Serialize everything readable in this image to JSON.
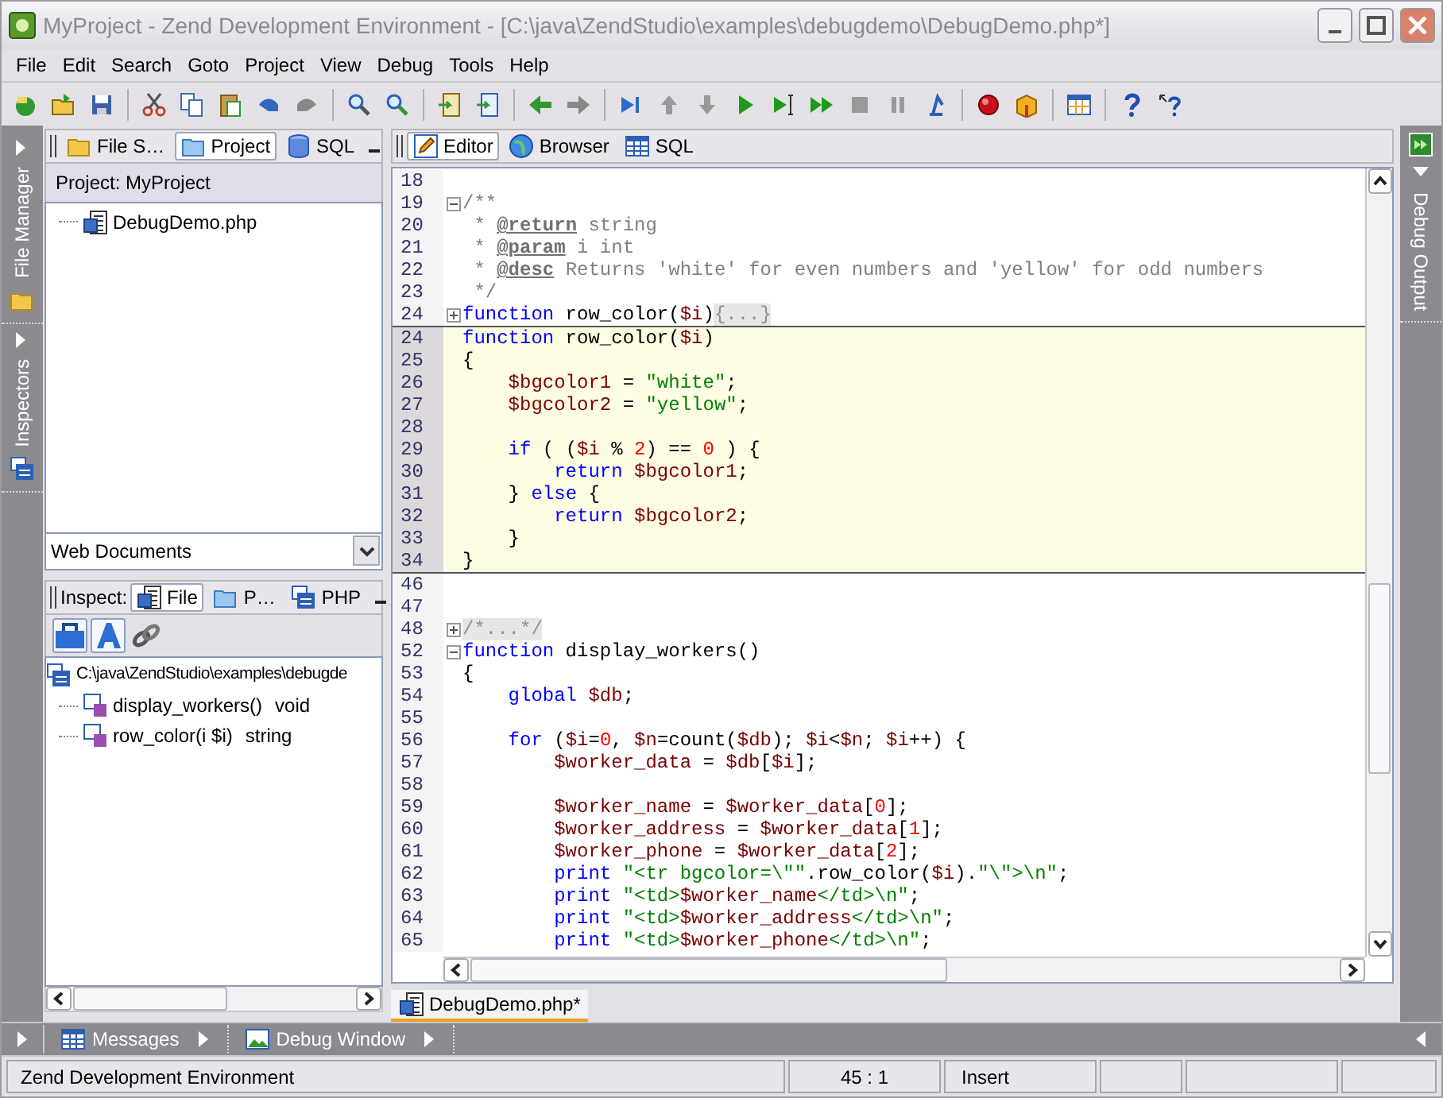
{
  "window": {
    "title": "MyProject - Zend Development Environment - [C:\\java\\ZendStudio\\examples\\debugdemo\\DebugDemo.php*]"
  },
  "menu": [
    "File",
    "Edit",
    "Search",
    "Goto",
    "Project",
    "View",
    "Debug",
    "Tools",
    "Help"
  ],
  "left_sidebar": [
    {
      "label": "File Manager"
    },
    {
      "label": "Inspectors"
    }
  ],
  "project_panel": {
    "tabs": [
      {
        "label": "File S…",
        "selected": false
      },
      {
        "label": "Project",
        "selected": true
      },
      {
        "label": "SQL",
        "selected": false
      }
    ],
    "header": "Project: MyProject",
    "tree": [
      {
        "label": "DebugDemo.php"
      }
    ],
    "dropdown": {
      "value": "Web Documents"
    }
  },
  "inspector_panel": {
    "label": "Inspect:",
    "tabs": [
      {
        "label": "File",
        "selected": true
      },
      {
        "label": "P…",
        "selected": false
      },
      {
        "label": "PHP",
        "selected": false
      }
    ],
    "tree": [
      {
        "label": "C:\\java\\ZendStudio\\examples\\debugde",
        "children": [
          {
            "label": "display_workers()",
            "type": "void"
          },
          {
            "label": "row_color(i $i)",
            "type": "string"
          }
        ]
      }
    ]
  },
  "editor_tabs": [
    {
      "label": "Editor",
      "selected": true
    },
    {
      "label": "Browser",
      "selected": false
    },
    {
      "label": "SQL",
      "selected": false
    }
  ],
  "code_sections": [
    {
      "kind": "main",
      "lines": [
        {
          "n": "18"
        },
        {
          "n": "19",
          "fold_expanded": true,
          "tokens": [
            {
              "kind": "doc",
              "text": "/**"
            }
          ]
        },
        {
          "n": "20",
          "tokens": [
            {
              "kind": "doc",
              "text": " * "
            },
            {
              "kind": "doctag",
              "text": "@return"
            },
            {
              "kind": "doc",
              "text": " string"
            }
          ]
        },
        {
          "n": "21",
          "tokens": [
            {
              "kind": "doc",
              "text": " * "
            },
            {
              "kind": "doctag",
              "text": "@param"
            },
            {
              "kind": "doc",
              "text": " i int"
            }
          ]
        },
        {
          "n": "22",
          "tokens": [
            {
              "kind": "doc",
              "text": " * "
            },
            {
              "kind": "doctag",
              "text": "@desc"
            },
            {
              "kind": "doc",
              "text": " Returns 'white' for even numbers and 'yellow' for odd numbers"
            }
          ]
        },
        {
          "n": "23",
          "tokens": [
            {
              "kind": "doc",
              "text": " */"
            }
          ]
        },
        {
          "n": "24",
          "fold_expanded": false,
          "tokens": [
            {
              "kind": "kw",
              "text": "function"
            },
            {
              "kind": "plain",
              "text": " row_color("
            },
            {
              "kind": "var",
              "text": "$i"
            },
            {
              "kind": "plain",
              "text": ")"
            },
            {
              "kind": "folded",
              "text": "{...}"
            }
          ]
        }
      ]
    },
    {
      "kind": "peek",
      "lines": [
        {
          "n": "24",
          "tokens": [
            {
              "kind": "kw",
              "text": "function"
            },
            {
              "kind": "plain",
              "text": " row_color("
            },
            {
              "kind": "var",
              "text": "$i"
            },
            {
              "kind": "plain",
              "text": ")"
            }
          ]
        },
        {
          "n": "25",
          "tokens": [
            {
              "kind": "plain",
              "text": "{"
            }
          ]
        },
        {
          "n": "26",
          "tokens": [
            {
              "kind": "var",
              "text": "    $bgcolor1"
            },
            {
              "kind": "plain",
              "text": " = "
            },
            {
              "kind": "str",
              "text": "\"white\""
            },
            {
              "kind": "plain",
              "text": ";"
            }
          ]
        },
        {
          "n": "27",
          "tokens": [
            {
              "kind": "var",
              "text": "    $bgcolor2"
            },
            {
              "kind": "plain",
              "text": " = "
            },
            {
              "kind": "str",
              "text": "\"yellow\""
            },
            {
              "kind": "plain",
              "text": ";"
            }
          ]
        },
        {
          "n": "28"
        },
        {
          "n": "29",
          "tokens": [
            {
              "kind": "kw",
              "text": "    if"
            },
            {
              "kind": "plain",
              "text": " ( ("
            },
            {
              "kind": "var",
              "text": "$i"
            },
            {
              "kind": "plain",
              "text": " % "
            },
            {
              "kind": "num",
              "text": "2"
            },
            {
              "kind": "plain",
              "text": ") == "
            },
            {
              "kind": "num",
              "text": "0"
            },
            {
              "kind": "plain",
              "text": " ) {"
            }
          ]
        },
        {
          "n": "30",
          "tokens": [
            {
              "kind": "kw",
              "text": "        return"
            },
            {
              "kind": "var",
              "text": " $bgcolor1"
            },
            {
              "kind": "plain",
              "text": ";"
            }
          ]
        },
        {
          "n": "31",
          "tokens": [
            {
              "kind": "plain",
              "text": "    } "
            },
            {
              "kind": "kw",
              "text": "else"
            },
            {
              "kind": "plain",
              "text": " {"
            }
          ]
        },
        {
          "n": "32",
          "tokens": [
            {
              "kind": "kw",
              "text": "        return"
            },
            {
              "kind": "var",
              "text": " $bgcolor2"
            },
            {
              "kind": "plain",
              "text": ";"
            }
          ]
        },
        {
          "n": "33",
          "tokens": [
            {
              "kind": "plain",
              "text": "    }"
            }
          ]
        },
        {
          "n": "34",
          "tokens": [
            {
              "kind": "plain",
              "text": "}"
            }
          ]
        }
      ]
    },
    {
      "kind": "main",
      "lines": [
        {
          "n": "46"
        },
        {
          "n": "47"
        },
        {
          "n": "48",
          "fold_expanded": false,
          "tokens": [
            {
              "kind": "folded",
              "text": "/*...*/"
            }
          ]
        },
        {
          "n": "52",
          "fold_expanded": true,
          "tokens": [
            {
              "kind": "kw",
              "text": "function"
            },
            {
              "kind": "plain",
              "text": " display_workers()"
            }
          ]
        },
        {
          "n": "53",
          "tokens": [
            {
              "kind": "plain",
              "text": "{"
            }
          ]
        },
        {
          "n": "54",
          "tokens": [
            {
              "kind": "kw",
              "text": "    global"
            },
            {
              "kind": "var",
              "text": " $db"
            },
            {
              "kind": "plain",
              "text": ";"
            }
          ]
        },
        {
          "n": "55"
        },
        {
          "n": "56",
          "tokens": [
            {
              "kind": "kw",
              "text": "    for"
            },
            {
              "kind": "plain",
              "text": " ("
            },
            {
              "kind": "var",
              "text": "$i"
            },
            {
              "kind": "plain",
              "text": "="
            },
            {
              "kind": "num",
              "text": "0"
            },
            {
              "kind": "plain",
              "text": ", "
            },
            {
              "kind": "var",
              "text": "$n"
            },
            {
              "kind": "plain",
              "text": "=count("
            },
            {
              "kind": "var",
              "text": "$db"
            },
            {
              "kind": "plain",
              "text": "); "
            },
            {
              "kind": "var",
              "text": "$i"
            },
            {
              "kind": "plain",
              "text": "<"
            },
            {
              "kind": "var",
              "text": "$n"
            },
            {
              "kind": "plain",
              "text": "; "
            },
            {
              "kind": "var",
              "text": "$i"
            },
            {
              "kind": "plain",
              "text": "++) {"
            }
          ]
        },
        {
          "n": "57",
          "tokens": [
            {
              "kind": "var",
              "text": "        $worker_data"
            },
            {
              "kind": "plain",
              "text": " = "
            },
            {
              "kind": "var",
              "text": "$db"
            },
            {
              "kind": "plain",
              "text": "["
            },
            {
              "kind": "var",
              "text": "$i"
            },
            {
              "kind": "plain",
              "text": "];"
            }
          ]
        },
        {
          "n": "58"
        },
        {
          "n": "59",
          "tokens": [
            {
              "kind": "var",
              "text": "        $worker_name"
            },
            {
              "kind": "plain",
              "text": " = "
            },
            {
              "kind": "var",
              "text": "$worker_data"
            },
            {
              "kind": "plain",
              "text": "["
            },
            {
              "kind": "num",
              "text": "0"
            },
            {
              "kind": "plain",
              "text": "];"
            }
          ]
        },
        {
          "n": "60",
          "tokens": [
            {
              "kind": "var",
              "text": "        $worker_address"
            },
            {
              "kind": "plain",
              "text": " = "
            },
            {
              "kind": "var",
              "text": "$worker_data"
            },
            {
              "kind": "plain",
              "text": "["
            },
            {
              "kind": "num",
              "text": "1"
            },
            {
              "kind": "plain",
              "text": "];"
            }
          ]
        },
        {
          "n": "61",
          "tokens": [
            {
              "kind": "var",
              "text": "        $worker_phone"
            },
            {
              "kind": "plain",
              "text": " = "
            },
            {
              "kind": "var",
              "text": "$worker_data"
            },
            {
              "kind": "plain",
              "text": "["
            },
            {
              "kind": "num",
              "text": "2"
            },
            {
              "kind": "plain",
              "text": "];"
            }
          ]
        },
        {
          "n": "62",
          "tokens": [
            {
              "kind": "kw",
              "text": "        print"
            },
            {
              "kind": "str",
              "text": " \"<tr bgcolor=\\\"\""
            },
            {
              "kind": "plain",
              "text": ".row_color("
            },
            {
              "kind": "var",
              "text": "$i"
            },
            {
              "kind": "plain",
              "text": ")."
            },
            {
              "kind": "str",
              "text": "\"\\\">\\n\""
            },
            {
              "kind": "plain",
              "text": ";"
            }
          ]
        },
        {
          "n": "63",
          "tokens": [
            {
              "kind": "kw",
              "text": "        print"
            },
            {
              "kind": "str",
              "text": " \"<td>"
            },
            {
              "kind": "var",
              "text": "$worker_name"
            },
            {
              "kind": "str",
              "text": "</td>\\n\""
            },
            {
              "kind": "plain",
              "text": ";"
            }
          ]
        },
        {
          "n": "64",
          "tokens": [
            {
              "kind": "kw",
              "text": "        print"
            },
            {
              "kind": "str",
              "text": " \"<td>"
            },
            {
              "kind": "var",
              "text": "$worker_address"
            },
            {
              "kind": "str",
              "text": "</td>\\n\""
            },
            {
              "kind": "plain",
              "text": ";"
            }
          ]
        },
        {
          "n": "65",
          "tokens": [
            {
              "kind": "kw",
              "text": "        print"
            },
            {
              "kind": "str",
              "text": " \"<td>"
            },
            {
              "kind": "var",
              "text": "$worker_phone"
            },
            {
              "kind": "str",
              "text": "</td>\\n\""
            },
            {
              "kind": "plain",
              "text": ";"
            }
          ]
        }
      ]
    }
  ],
  "document_tabs": [
    {
      "label": "DebugDemo.php*",
      "selected": true
    }
  ],
  "right_sidebar": [
    {
      "label": "Debug Output"
    }
  ],
  "dock_bar": [
    {
      "label": "Messages"
    },
    {
      "label": "Debug Window"
    }
  ],
  "status_bar": {
    "message": "Zend Development Environment",
    "position": "45 : 1",
    "mode": "Insert"
  }
}
